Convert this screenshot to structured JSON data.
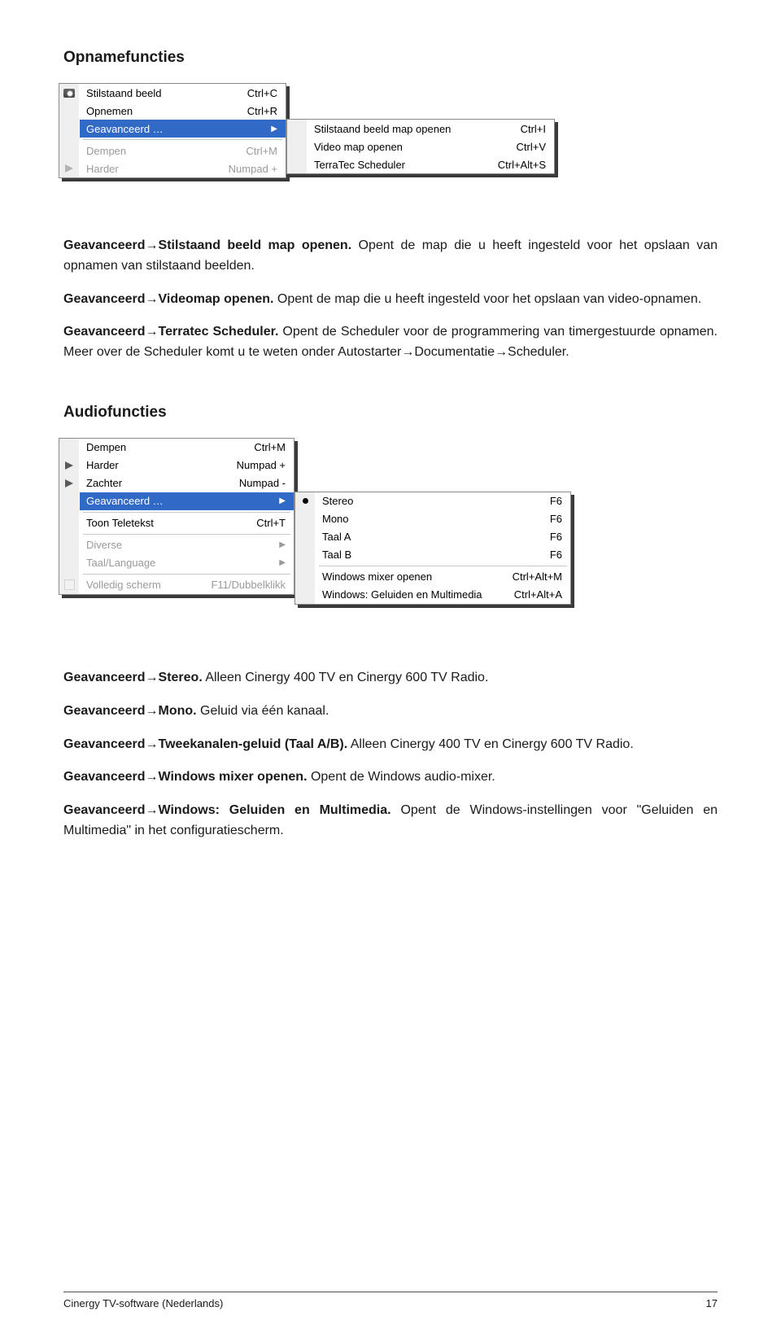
{
  "headings": {
    "opname": "Opnamefuncties",
    "audio": "Audiofuncties"
  },
  "menu1": {
    "left": {
      "items": [
        {
          "label": "Stilstaand beeld",
          "shortcut": "Ctrl+C"
        },
        {
          "label": "Opnemen",
          "shortcut": "Ctrl+R"
        },
        {
          "label": "Geavanceerd …",
          "arrow": true,
          "selected": true
        },
        {
          "sep": true
        },
        {
          "label": "Dempen",
          "shortcut": "Ctrl+M",
          "faded": true
        },
        {
          "label": "Harder",
          "shortcut": "Numpad +",
          "faded": true
        }
      ]
    },
    "right": {
      "items": [
        {
          "label": "Stilstaand beeld map openen",
          "shortcut": "Ctrl+I"
        },
        {
          "label": "Video map openen",
          "shortcut": "Ctrl+V"
        },
        {
          "label": "TerraTec Scheduler",
          "shortcut": "Ctrl+Alt+S"
        }
      ]
    }
  },
  "para1": {
    "lead": "Geavanceerd",
    "arrow": "→",
    "bold2": "Stilstaand beeld map openen.",
    "rest": " Opent de map die u heeft ingesteld voor het opslaan van opnamen van stilstaand beelden."
  },
  "para2": {
    "lead": "Geavanceerd",
    "arrow": "→",
    "bold2": "Videomap openen.",
    "rest": " Opent de map die u heeft ingesteld voor het opslaan van video-opnamen."
  },
  "para3": {
    "lead": "Geavanceerd",
    "arrow": "→",
    "bold2": "Terratec Scheduler.",
    "rest": " Opent de Scheduler voor de programmering van timergestuurde opnamen. Meer over de Scheduler komt u te weten onder Autostarter→Documentatie→Scheduler."
  },
  "menu2": {
    "left": {
      "items": [
        {
          "label": "Dempen",
          "shortcut": "Ctrl+M"
        },
        {
          "label": "Harder",
          "shortcut": "Numpad +"
        },
        {
          "label": "Zachter",
          "shortcut": "Numpad -"
        },
        {
          "label": "Geavanceerd …",
          "arrow": true,
          "selected": true
        },
        {
          "sep": true
        },
        {
          "label": "Toon Teletekst",
          "shortcut": "Ctrl+T"
        },
        {
          "sep": true
        },
        {
          "label": "Diverse",
          "arrow": true,
          "faded": true
        },
        {
          "label": "Taal/Language",
          "arrow": true,
          "faded": true
        },
        {
          "sep": true
        },
        {
          "label": "Volledig scherm",
          "shortcut": "F11/Dubbelklikk",
          "faded": true
        }
      ]
    },
    "right": {
      "items": [
        {
          "label": "Stereo",
          "shortcut": "F6",
          "dot": true
        },
        {
          "label": "Mono",
          "shortcut": "F6"
        },
        {
          "label": "Taal A",
          "shortcut": "F6"
        },
        {
          "label": "Taal B",
          "shortcut": "F6"
        },
        {
          "sep": true
        },
        {
          "label": "Windows mixer openen",
          "shortcut": "Ctrl+Alt+M"
        },
        {
          "label": "Windows: Geluiden en Multimedia",
          "shortcut": "Ctrl+Alt+A"
        }
      ]
    }
  },
  "para4": {
    "lead": "Geavanceerd",
    "arrow": "→",
    "bold2": "Stereo.",
    "rest": " Alleen Cinergy 400 TV en Cinergy 600 TV Radio."
  },
  "para5": {
    "lead": "Geavanceerd",
    "arrow": "→",
    "bold2": "Mono.",
    "rest": " Geluid via één kanaal."
  },
  "para6": {
    "lead": "Geavanceerd",
    "arrow": "→",
    "bold2": "Tweekanalen-geluid (Taal A/B).",
    "rest": " Alleen Cinergy 400 TV en Cinergy 600 TV Radio."
  },
  "para7": {
    "lead": "Geavanceerd",
    "arrow": "→",
    "bold2": "Windows mixer openen.",
    "rest": " Opent de Windows audio-mixer."
  },
  "para8": {
    "lead": "Geavanceerd",
    "arrow": "→",
    "bold2": "Windows: Geluiden en Multimedia.",
    "rest": " Opent de Windows-instellingen voor \"Geluiden en Multimedia\" in het configuratiescherm."
  },
  "footer": {
    "left": "Cinergy TV-software (Nederlands)",
    "right": "17"
  }
}
